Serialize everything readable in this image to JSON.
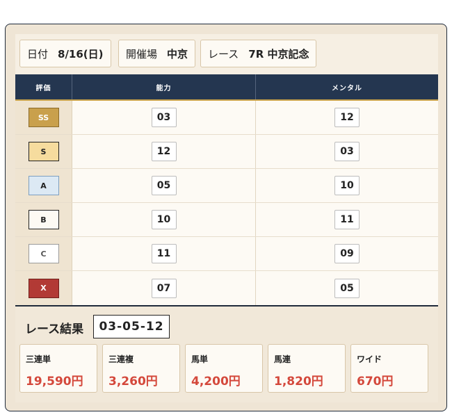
{
  "info": {
    "date_label": "日付",
    "date_value": "8/16(日)",
    "venue_label": "開催場",
    "venue_value": "中京",
    "race_label": "レース",
    "race_value": "7R 中京記念"
  },
  "table": {
    "headers": [
      "評価",
      "能力",
      "メンタル"
    ],
    "rows": [
      {
        "grade": "SS",
        "ability": "03",
        "mental": "12"
      },
      {
        "grade": "S",
        "ability": "12",
        "mental": "03"
      },
      {
        "grade": "A",
        "ability": "05",
        "mental": "10"
      },
      {
        "grade": "B",
        "ability": "10",
        "mental": "11"
      },
      {
        "grade": "C",
        "ability": "11",
        "mental": "09"
      },
      {
        "grade": "X",
        "ability": "07",
        "mental": "05"
      }
    ]
  },
  "grade_colors": {
    "SS": {
      "bg": "#c9a04c",
      "fg": "#ffffff",
      "border": "#8a6a2a"
    },
    "S": {
      "bg": "#f6dc9e",
      "fg": "#222222",
      "border": "#222222"
    },
    "A": {
      "bg": "#dce9f4",
      "fg": "#222222",
      "border": "#7d9fc0"
    },
    "B": {
      "bg": "#fdfaf4",
      "fg": "#222222",
      "border": "#222222"
    },
    "C": {
      "bg": "#ffffff",
      "fg": "#555555",
      "border": "#9a9a9a"
    },
    "X": {
      "bg": "#b23a35",
      "fg": "#ffffff",
      "border": "#6e1f1c"
    }
  },
  "result": {
    "title": "レース結果",
    "combo": "03-05-12",
    "payouts": [
      {
        "label": "三連単",
        "amount": "19,590円"
      },
      {
        "label": "三連複",
        "amount": "3,260円"
      },
      {
        "label": "馬単",
        "amount": "4,200円"
      },
      {
        "label": "馬連",
        "amount": "1,820円"
      },
      {
        "label": "ワイド",
        "amount": "670円"
      }
    ]
  }
}
